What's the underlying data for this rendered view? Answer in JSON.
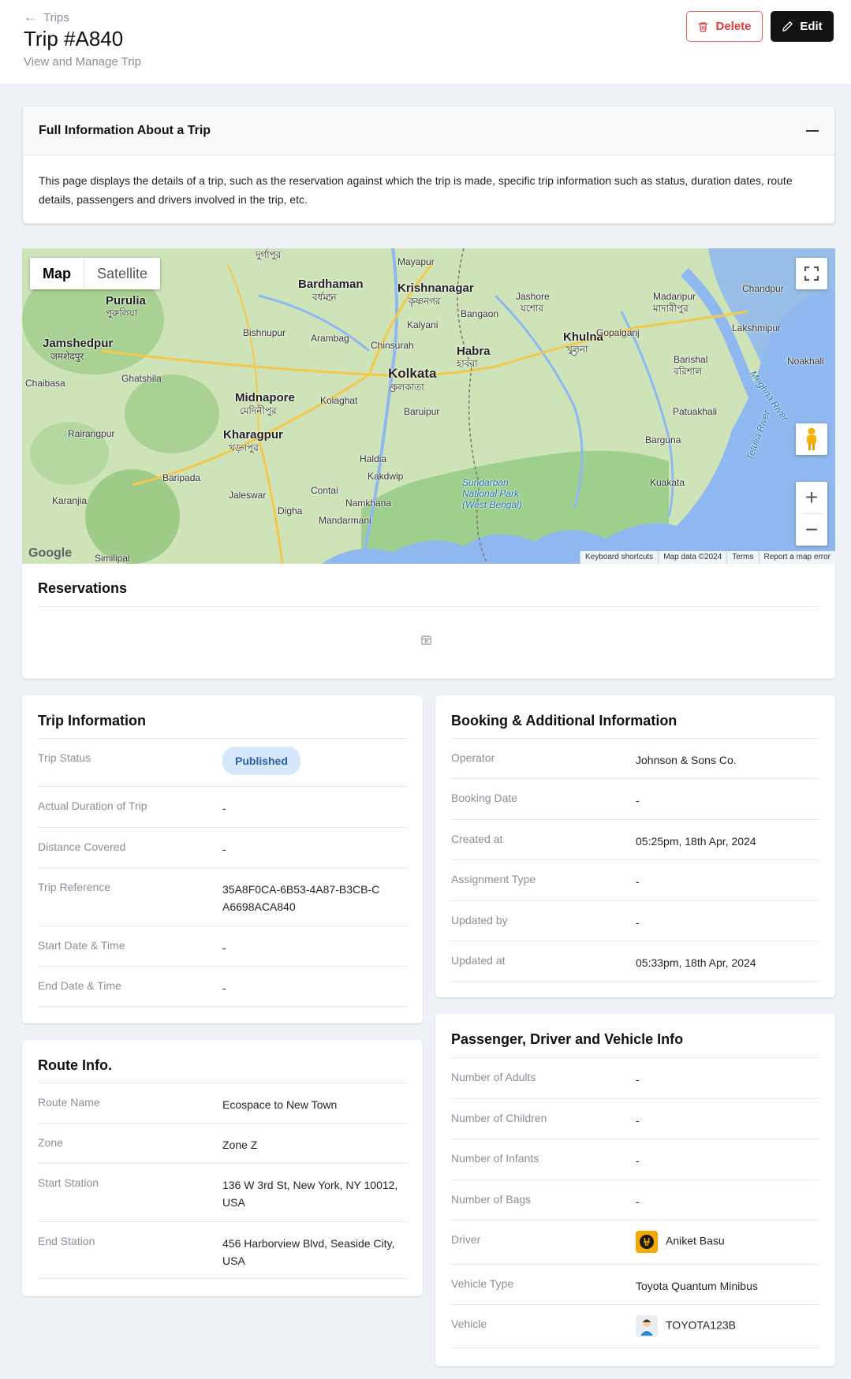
{
  "header": {
    "breadcrumb": "Trips",
    "title": "Trip #A840",
    "subtitle": "View and Manage Trip",
    "delete_label": "Delete",
    "edit_label": "Edit"
  },
  "info": {
    "title": "Full Information About a Trip",
    "body": "This page displays the details of a trip, such as the reservation against which the trip is made, specific trip information such as status, duration dates, route details, passengers and drivers involved in the trip, etc."
  },
  "map": {
    "tab_map": "Map",
    "tab_satellite": "Satellite",
    "logo": "Google",
    "attrib": [
      "Keyboard shortcuts",
      "Map data ©2024",
      "Terms",
      "Report a map error"
    ],
    "places": {
      "kolkata": "Kolkata",
      "kolkata_bn": "কলকাতা",
      "bardhaman": "Bardhaman",
      "bardhaman_bn": "বর্ধমান",
      "krishnanagar": "Krishnanagar",
      "krishnanagar_bn": "কৃষ্ণনগর",
      "purulia": "Purulia",
      "purulia_bn": "পুরুলিয়া",
      "jamshedpur": "Jamshedpur",
      "jamshedpur_bn": "जमशेदपुर",
      "midnapore": "Midnapore",
      "midnapore_bn": "মেদিনীপুর",
      "kharagpur": "Kharagpur",
      "kharagpur_bn": "খড়্গপুর",
      "khulna": "Khulna",
      "khulna_bn": "খুলনা",
      "habra": "Habra",
      "habra_bn": "হাবরা",
      "jashore": "Jashore",
      "jashore_bn": "যশোর",
      "madaripur": "Madaripur",
      "madaripur_bn": "মাদারীপুর",
      "barishal": "Barishal",
      "barishal_bn": "বরিশাল",
      "haldia": "Haldia",
      "sundarban": "Sundarban National Park (West Bengal)",
      "bishnupur": "Bishnupur",
      "arambag": "Arambag",
      "chinsurah": "Chinsurah",
      "kalyani": "Kalyani",
      "bangaon": "Bangaon",
      "baruipur": "Baruipur",
      "kolaghat": "Kolaghat",
      "patuakhali": "Patuakhali",
      "barguna": "Barguna",
      "kuakata": "Kuakata",
      "gopalganj": "Gopalganj",
      "chandpur": "Chandpur",
      "lakshmipur": "Lakshmipur",
      "noakhali": "Noakhali",
      "ghatshila": "Ghatshila",
      "rairangpur": "Rairangpur",
      "baripada": "Baripada",
      "jaleswar": "Jaleswar",
      "contai": "Contai",
      "digha": "Digha",
      "namkhana": "Namkhana",
      "kakdwip": "Kakdwip",
      "karanjia": "Karanjia",
      "mandarmani": "Mandarmani",
      "mayapur": "Mayapur",
      "durgapur": "দুর্গাপুর",
      "chaibasa": "Chaibasa",
      "meghna": "Meghna River",
      "tetulia": "Tetulia River",
      "similipal": "Similipal"
    }
  },
  "reservations": {
    "title": "Reservations"
  },
  "trip_info": {
    "title": "Trip Information",
    "rows": [
      {
        "label": "Trip Status",
        "value": "Published"
      },
      {
        "label": "Actual Duration of Trip",
        "value": "-"
      },
      {
        "label": "Distance Covered",
        "value": "-"
      },
      {
        "label": "Trip Reference",
        "value": "35A8F0CA-6B53-4A87-B3CB-CA6698ACA840"
      },
      {
        "label": "Start Date & Time",
        "value": "-"
      },
      {
        "label": "End Date & Time",
        "value": "-"
      }
    ]
  },
  "booking": {
    "title": "Booking & Additional Information",
    "rows": [
      {
        "label": "Operator",
        "value": "Johnson & Sons Co."
      },
      {
        "label": "Booking Date",
        "value": "-"
      },
      {
        "label": "Created at",
        "value": "05:25pm, 18th Apr, 2024"
      },
      {
        "label": "Assignment Type",
        "value": "-"
      },
      {
        "label": "Updated by",
        "value": "-"
      },
      {
        "label": "Updated at",
        "value": "05:33pm, 18th Apr, 2024"
      }
    ]
  },
  "route": {
    "title": "Route Info.",
    "rows": [
      {
        "label": "Route Name",
        "value": "Ecospace to New Town"
      },
      {
        "label": "Zone",
        "value": "Zone Z"
      },
      {
        "label": "Start Station",
        "value": "136 W 3rd St, New York, NY 10012, USA"
      },
      {
        "label": "End Station",
        "value": "456 Harborview Blvd, Seaside City, USA"
      }
    ]
  },
  "passenger": {
    "title": "Passenger, Driver and Vehicle Info",
    "rows": [
      {
        "label": "Number of Adults",
        "value": "-"
      },
      {
        "label": "Number of Children",
        "value": "-"
      },
      {
        "label": "Number of Infants",
        "value": "-"
      },
      {
        "label": "Number of Bags",
        "value": "-"
      },
      {
        "label": "Driver",
        "value": "Aniket Basu"
      },
      {
        "label": "Vehicle Type",
        "value": "Toyota Quantum Minibus"
      },
      {
        "label": "Vehicle",
        "value": "TOYOTA123B"
      }
    ]
  },
  "colors": {
    "accent_delete": "#e03a3a",
    "badge_bg": "#d6e7fb",
    "badge_text": "#2b5fa8"
  }
}
